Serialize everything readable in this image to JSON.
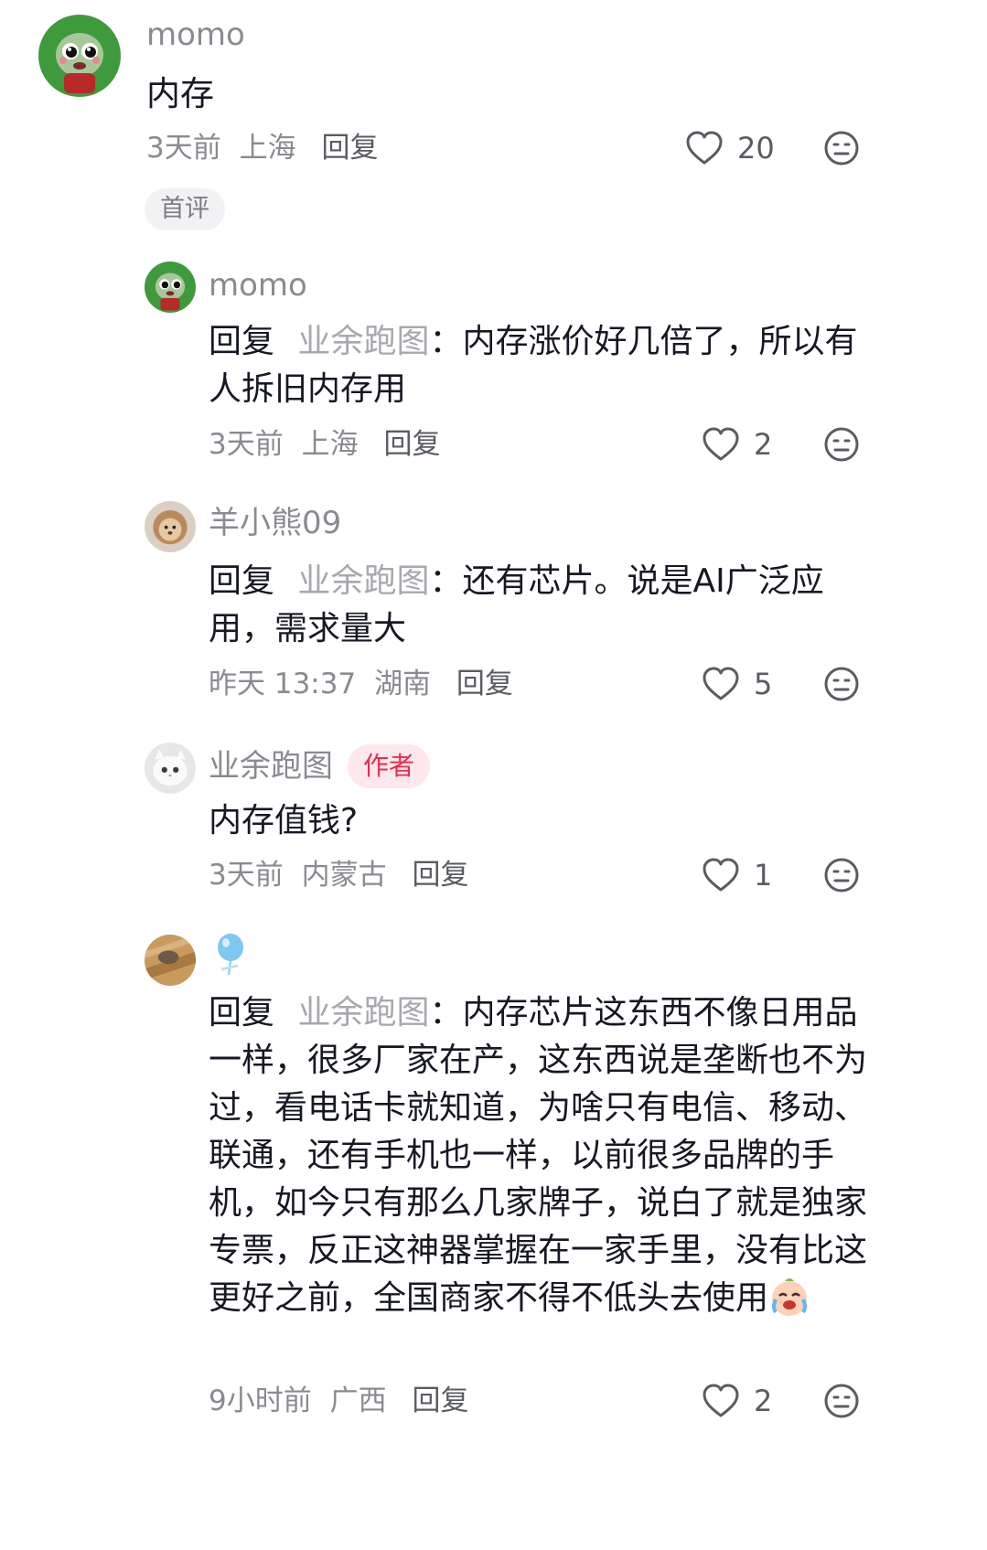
{
  "comments": [
    {
      "username": "momo",
      "text": "内存",
      "time": "3天前",
      "location": "上海",
      "reply_label": "回复",
      "likes": "20",
      "tag": "首评"
    },
    {
      "username": "momo",
      "reply_prefix": "回复",
      "reply_target": "业余跑图",
      "separator": "：",
      "text": "内存涨价好几倍了，所以有人拆旧内存用",
      "time": "3天前",
      "location": "上海",
      "reply_label": "回复",
      "likes": "2"
    },
    {
      "username": "羊小熊09",
      "reply_prefix": "回复",
      "reply_target": "业余跑图",
      "separator": "：",
      "text": "还有芯片。说是AI广泛应用，需求量大",
      "time": "昨天 13:37",
      "location": "湖南",
      "reply_label": "回复",
      "likes": "5"
    },
    {
      "username": "业余跑图",
      "author_badge": "作者",
      "text": "内存值钱?",
      "time": "3天前",
      "location": "内蒙古",
      "reply_label": "回复",
      "likes": "1"
    },
    {
      "username": "",
      "username_icon": "balloon-icon",
      "reply_prefix": "回复",
      "reply_target": "业余跑图",
      "separator": "：",
      "text": "内存芯片这东西不像日用品一样，很多厂家在产，这东西说是垄断也不为过，看电话卡就知道，为啥只有电信、移动、联通，还有手机也一样，以前很多品牌的手机，如今只有那么几家牌子，说白了就是独家专票，反正这神器掌握在一家手里，没有比这更好之前，全国商家不得不低头去使用",
      "trailing_emoji": "crying-laughing-emoji",
      "time": "9小时前",
      "location": "广西",
      "reply_label": "回复",
      "likes": "2"
    }
  ],
  "colors": {
    "text": "#161823",
    "secondary": "#8a8b91",
    "reply_target": "#a7a9ae",
    "author_badge_bg": "#fde8ec",
    "author_badge_text": "#f1294f",
    "tag_bg": "#f2f2f4"
  }
}
